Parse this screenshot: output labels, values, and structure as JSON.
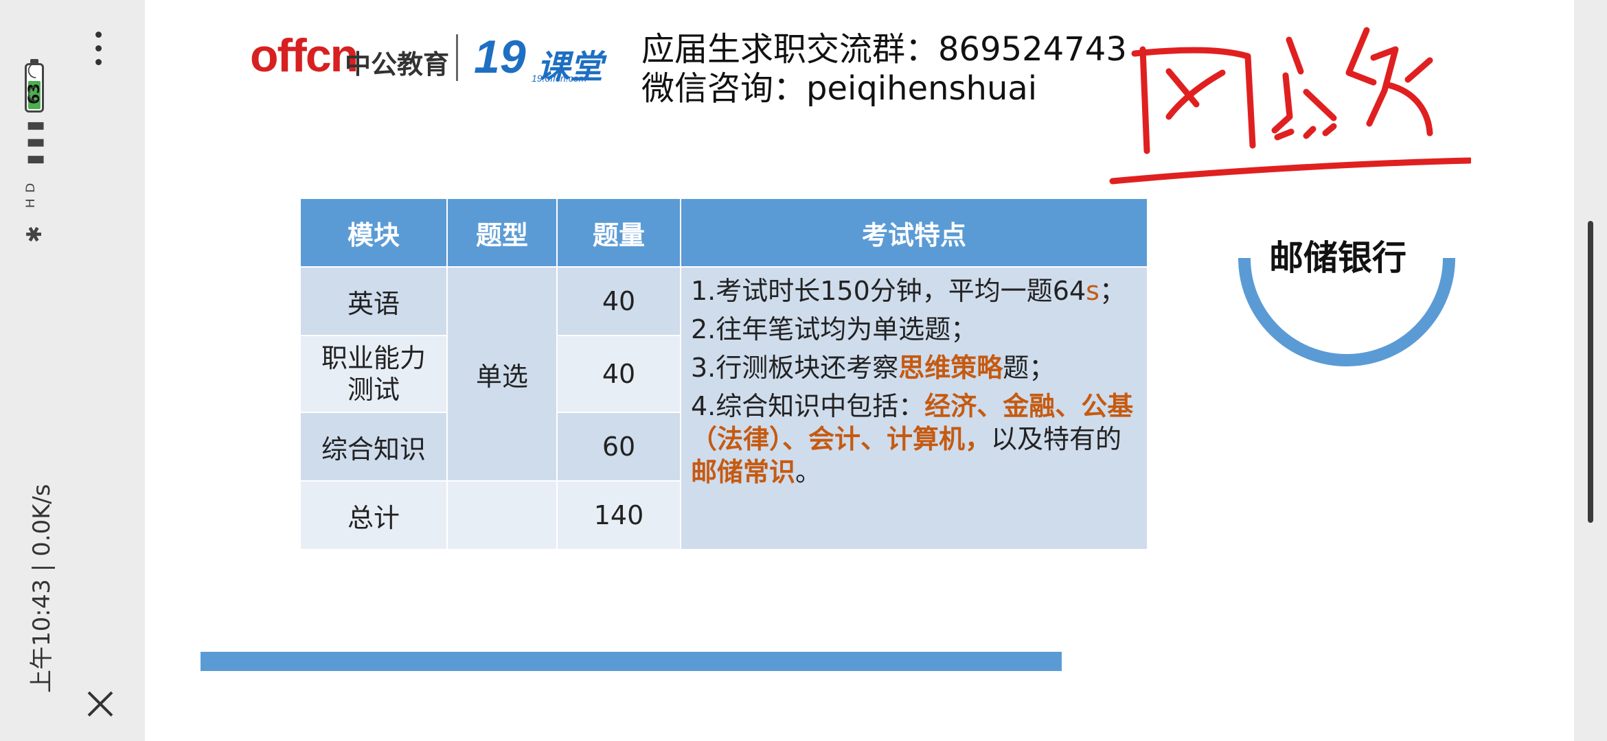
{
  "status_bar": {
    "time_and_speed": "上午10:43 | 0.0K/s",
    "battery_level": "63",
    "icons": [
      "bluetooth-icon",
      "hd-icon",
      "signal-icon",
      "wifi-icon",
      "battery-icon",
      "charging-icon",
      "alarm-icon"
    ]
  },
  "slide": {
    "logo": {
      "brand": "offcn",
      "brand_cn": "中公教育",
      "sub_num": "19",
      "sub_cn": "课堂",
      "sub_url": "19.offcn.com"
    },
    "contact": {
      "line1": "应届生求职交流群：869524743",
      "line2": "微信咨询：peiqihenshuai"
    },
    "handwriting": "风险",
    "bank": "邮储银行",
    "table": {
      "headers": [
        "模块",
        "题型",
        "题量",
        "考试特点"
      ],
      "rows": [
        {
          "module": "英语",
          "count": "40"
        },
        {
          "module_line1": "职业能力",
          "module_line2": "测试",
          "count": "40"
        },
        {
          "module": "综合知识",
          "count": "60"
        },
        {
          "module": "总计",
          "count": "140"
        }
      ],
      "question_type": "单选",
      "features": {
        "item1_prefix": "1.考试时长150分钟，平均一题64",
        "item1_unit": "s",
        "item1_suffix": "；",
        "item2": "2.往年笔试均为单选题；",
        "item3_prefix": "3.行测板块还考察",
        "item3_highlight": "思维策略",
        "item3_suffix": "题；",
        "item4_prefix": "4.综合知识中包括：",
        "item4_highlight": "经济、金融、公基（法律）、会计、计算机，",
        "item4_mid": "以及特有的",
        "item4_highlight2": "邮储常识",
        "item4_suffix": "。"
      }
    },
    "colors": {
      "accent_blue": "#5b9bd5",
      "highlight_orange": "#c55a11",
      "handwriting_red": "#e02020",
      "brand_red": "#d72020"
    }
  },
  "viewer": {
    "more_icon": "more-vertical-icon",
    "close_icon": "close-icon"
  }
}
